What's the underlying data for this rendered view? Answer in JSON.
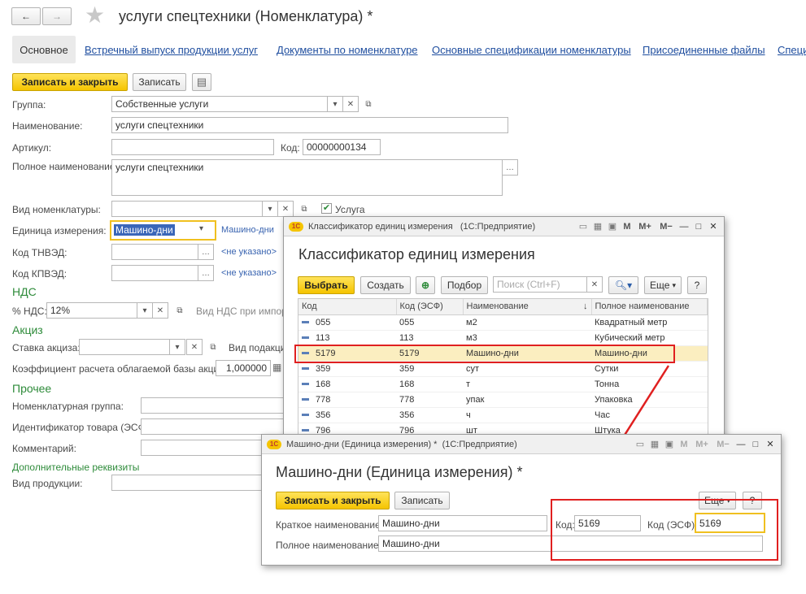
{
  "title": "услуги спецтехники (Номенклатура) *",
  "tabs": [
    "Основное",
    "Встречный выпуск продукции услуг",
    "Документы по номенклатуре",
    "Основные спецификации номенклатуры",
    "Присоединенные файлы",
    "Специ"
  ],
  "toolbar": {
    "save_close": "Записать и закрыть",
    "save": "Записать"
  },
  "form": {
    "group_label": "Группа:",
    "group_value": "Собственные услуги",
    "name_label": "Наименование:",
    "name_value": "услуги спецтехники",
    "article_label": "Артикул:",
    "code_label": "Код:",
    "code_value": "00000000134",
    "fullname_label": "Полное наименование:",
    "fullname_value": "услуги спецтехники",
    "kind_label": "Вид номенклатуры:",
    "service_label": "Услуга",
    "unit_label": "Единица измерения:",
    "unit_value": "Машино-дни",
    "unit_link": "Машино-дни",
    "tnved_label": "Код ТНВЭД:",
    "tnved_link": "<не указано>",
    "kpved_label": "Код КПВЭД:",
    "kpved_link": "<не указано>",
    "vat_section": "НДС",
    "vat_label": "% НДС:",
    "vat_value": "12%",
    "vat_import_label": "Вид НДС при импорте",
    "excise_section": "Акциз",
    "excise_rate_label": "Ставка акциза:",
    "excise_kind_label": "Вид подакциз",
    "coef_label": "Коэффициент расчета облагаемой базы акциза:",
    "coef_value": "1,000000",
    "other_section": "Прочее",
    "nomgroup_label": "Номенклатурная группа:",
    "esf_id_label": "Идентификатор товара (ЭСФ):",
    "comment_label": "Комментарий:",
    "extra_section": "Дополнительные реквизиты",
    "product_kind_label": "Вид продукции:"
  },
  "classifier": {
    "window_title": "Классификатор единиц измерения   (1С:Предприятие)",
    "heading": "Классификатор единиц измерения",
    "select": "Выбрать",
    "create": "Создать",
    "pick": "Подбор",
    "search_placeholder": "Поиск (Ctrl+F)",
    "more": "Еще",
    "columns": [
      "Код",
      "Код (ЭСФ)",
      "Наименование",
      "Полное наименование"
    ],
    "rows": [
      [
        "055",
        "055",
        "м2",
        "Квадратный метр"
      ],
      [
        "113",
        "113",
        "м3",
        "Кубический метр"
      ],
      [
        "5179",
        "5179",
        "Машино-дни",
        "Машино-дни"
      ],
      [
        "359",
        "359",
        "сут",
        "Сутки"
      ],
      [
        "168",
        "168",
        "т",
        "Тонна"
      ],
      [
        "778",
        "778",
        "упак",
        "Упаковка"
      ],
      [
        "356",
        "356",
        "ч",
        "Час"
      ],
      [
        "796",
        "796",
        "шт",
        "Штука"
      ]
    ],
    "selected_row": 2
  },
  "unit_form": {
    "window_title": "Машино-дни (Единица измерения) *  (1С:Предприятие)",
    "heading": "Машино-дни (Единица измерения) *",
    "save_close": "Записать и закрыть",
    "save": "Записать",
    "more": "Еще",
    "short_label": "Краткое наименование:",
    "short_value": "Машино-дни",
    "code_label": "Код:",
    "code_value": "5169",
    "esf_label": "Код (ЭСФ):",
    "esf_value": "5169",
    "full_label": "Полное наименование:",
    "full_value": "Машино-дни"
  },
  "colors": {
    "accent_yellow": "#f5c400",
    "link_blue": "#1f4e9f",
    "section_green": "#2e8b3a",
    "highlight_red": "#e02020",
    "selected_row": "#fbeec0"
  }
}
